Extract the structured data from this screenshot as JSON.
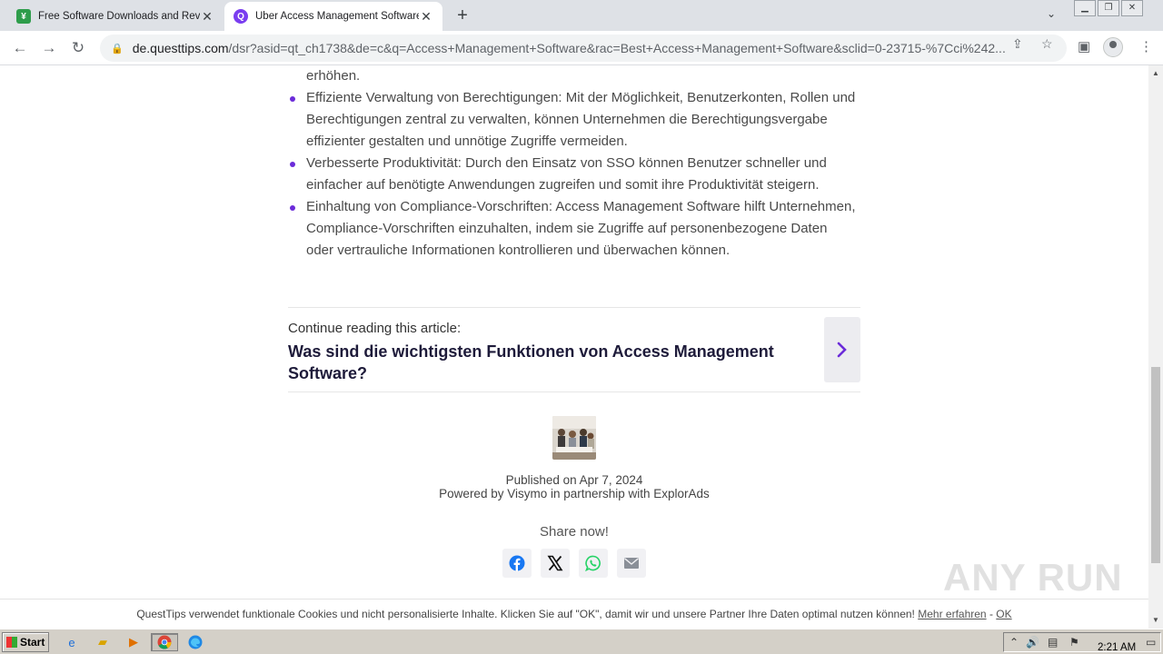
{
  "browser": {
    "tabs": [
      {
        "title": "Free Software Downloads and Revie",
        "favicon_color": "#2e9d4b",
        "active": false
      },
      {
        "title": "Über Access Management Software",
        "favicon_color": "#7a3df0",
        "active": true
      }
    ],
    "url_host": "de.questtips.com",
    "url_path": "/dsr?asid=qt_ch1738&de=c&q=Access+Management+Software&rac=Best+Access+Management+Software&sclid=0-23715-%7Cci%242..."
  },
  "article": {
    "bullets": [
      {
        "text": "erhöhen.",
        "dot": false
      },
      {
        "text": "Effiziente Verwaltung von Berechtigungen: Mit der Möglichkeit, Benutzerkonten, Rollen und Berechtigungen zentral zu verwalten, können Unternehmen die Berechtigungsvergabe effizienter gestalten und unnötige Zugriffe vermeiden.",
        "dot": true
      },
      {
        "text": "Verbesserte Produktivität: Durch den Einsatz von SSO können Benutzer schneller und einfacher auf benötigte Anwendungen zugreifen und somit ihre Produktivität steigern.",
        "dot": true
      },
      {
        "text": "Einhaltung von Compliance-Vorschriften: Access Management Software hilft Unternehmen, Compliance-Vorschriften einzuhalten, indem sie Zugriffe auf personenbezogene Daten oder vertrauliche Informationen kontrollieren und überwachen können.",
        "dot": true
      }
    ],
    "continue_label": "Continue reading this article:",
    "continue_title": "Was sind die wichtigsten Funktionen von Access Management Software?",
    "published": "Published on Apr 7, 2024",
    "powered_by": "Powered by Visymo in partnership with ExplorAds",
    "share_title": "Share now!"
  },
  "cookie": {
    "text": "QuestTips verwendet funktionale Cookies und nicht personalisierte Inhalte. Klicken Sie auf \"OK\", damit wir und unsere Partner Ihre Daten optimal nutzen können!",
    "more": "Mehr erfahren",
    "separator": "-",
    "ok": "OK"
  },
  "watermark": "ANY RUN",
  "taskbar": {
    "start": "Start",
    "clock": "2:21 AM"
  },
  "colors": {
    "accent": "#6b2bd9",
    "facebook": "#1877f2",
    "whatsapp": "#25d366"
  }
}
